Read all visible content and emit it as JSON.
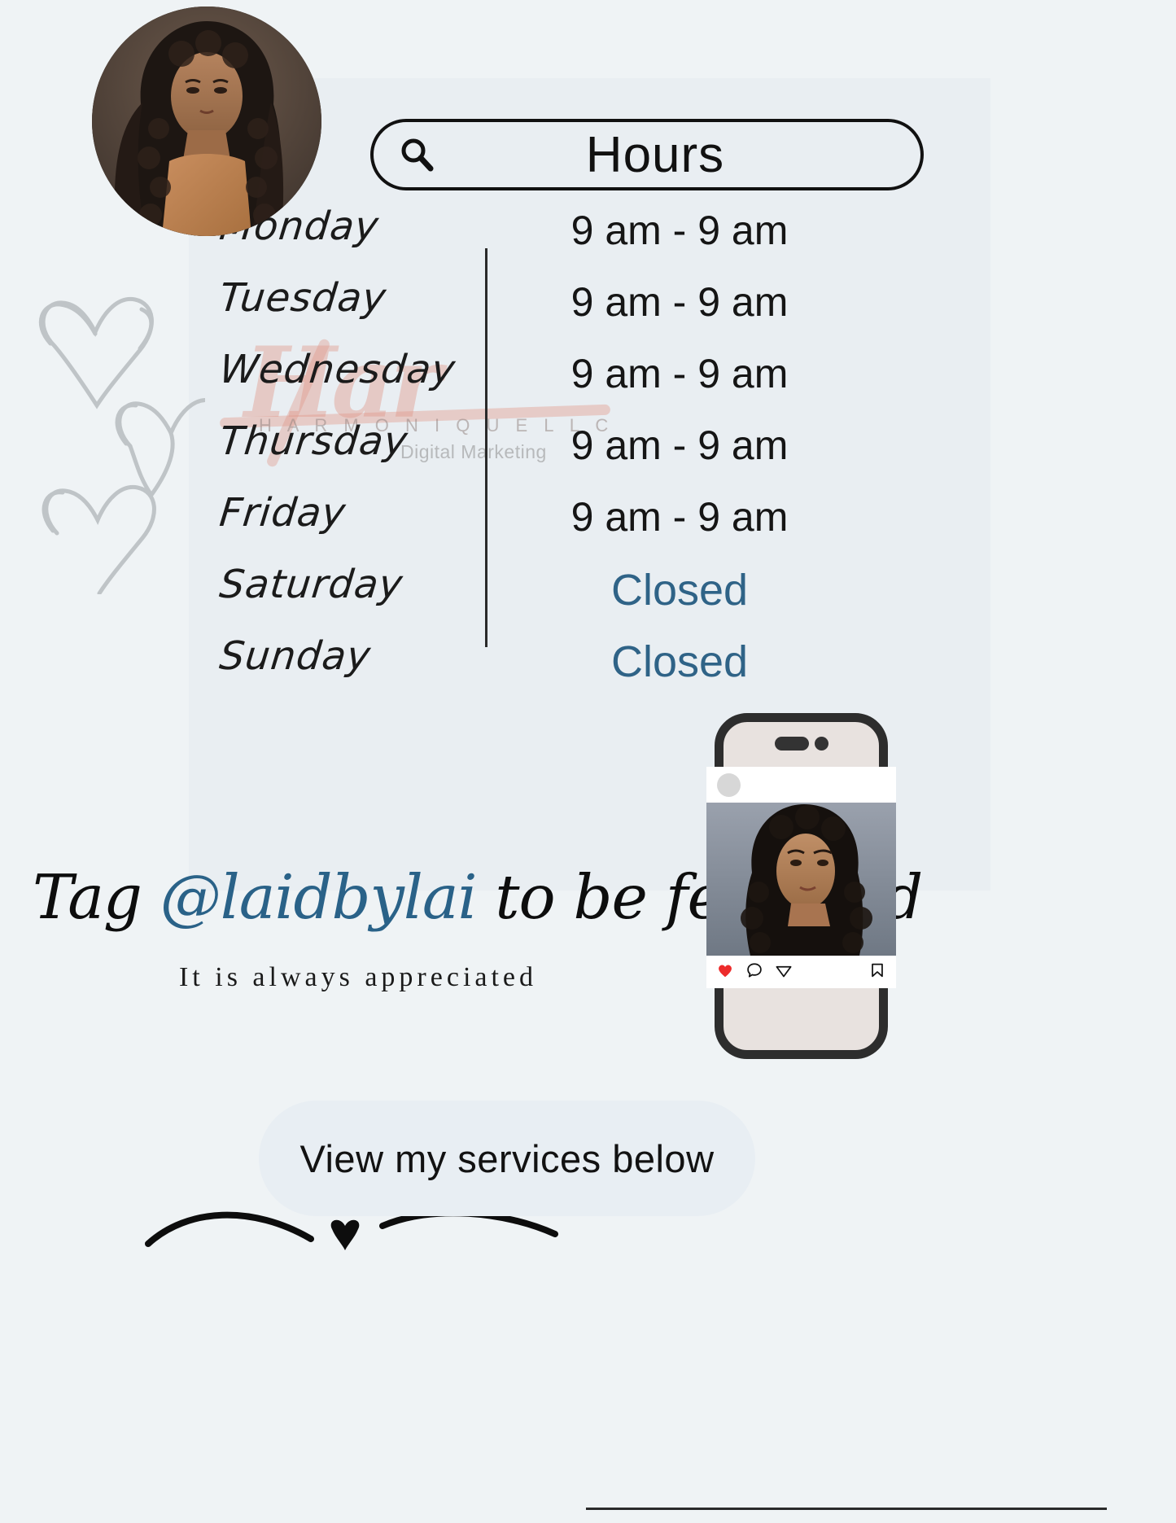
{
  "search": {
    "label": "Hours",
    "icon": "search-icon"
  },
  "watermark": {
    "script": "Har",
    "brand": "H A R M O N I Q U E   L L C",
    "subtitle": "Digital Marketing"
  },
  "hours": {
    "rows": [
      {
        "day": "Monday",
        "time": "9 am - 9 am",
        "closed": false
      },
      {
        "day": "Tuesday",
        "time": "9 am - 9 am",
        "closed": false
      },
      {
        "day": "Wednesday",
        "time": "9 am - 9 am",
        "closed": false
      },
      {
        "day": "Thursday",
        "time": "9 am - 9 am",
        "closed": false
      },
      {
        "day": "Friday",
        "time": "9 am - 9 am",
        "closed": false
      },
      {
        "day": "Saturday",
        "time": "Closed",
        "closed": true
      },
      {
        "day": "Sunday",
        "time": "Closed",
        "closed": true
      }
    ]
  },
  "tagline": {
    "prefix": "Tag ",
    "handle": "@laidbylai",
    "suffix": " to be featured"
  },
  "appreciated_text": "It is always appreciated",
  "services_button": {
    "label": "View my services below"
  },
  "phone": {
    "instagram": {
      "like_icon": "heart-icon",
      "comment_icon": "comment-icon",
      "share_icon": "share-icon",
      "save_icon": "bookmark-icon"
    }
  },
  "colors": {
    "background": "#eff3f5",
    "panel": "#e9eef2",
    "accent_blue": "#2a6288",
    "closed_blue": "#2f6387",
    "watermark_pink": "#e09687",
    "heart_red": "#ed2b2b",
    "ink": "#111111"
  }
}
